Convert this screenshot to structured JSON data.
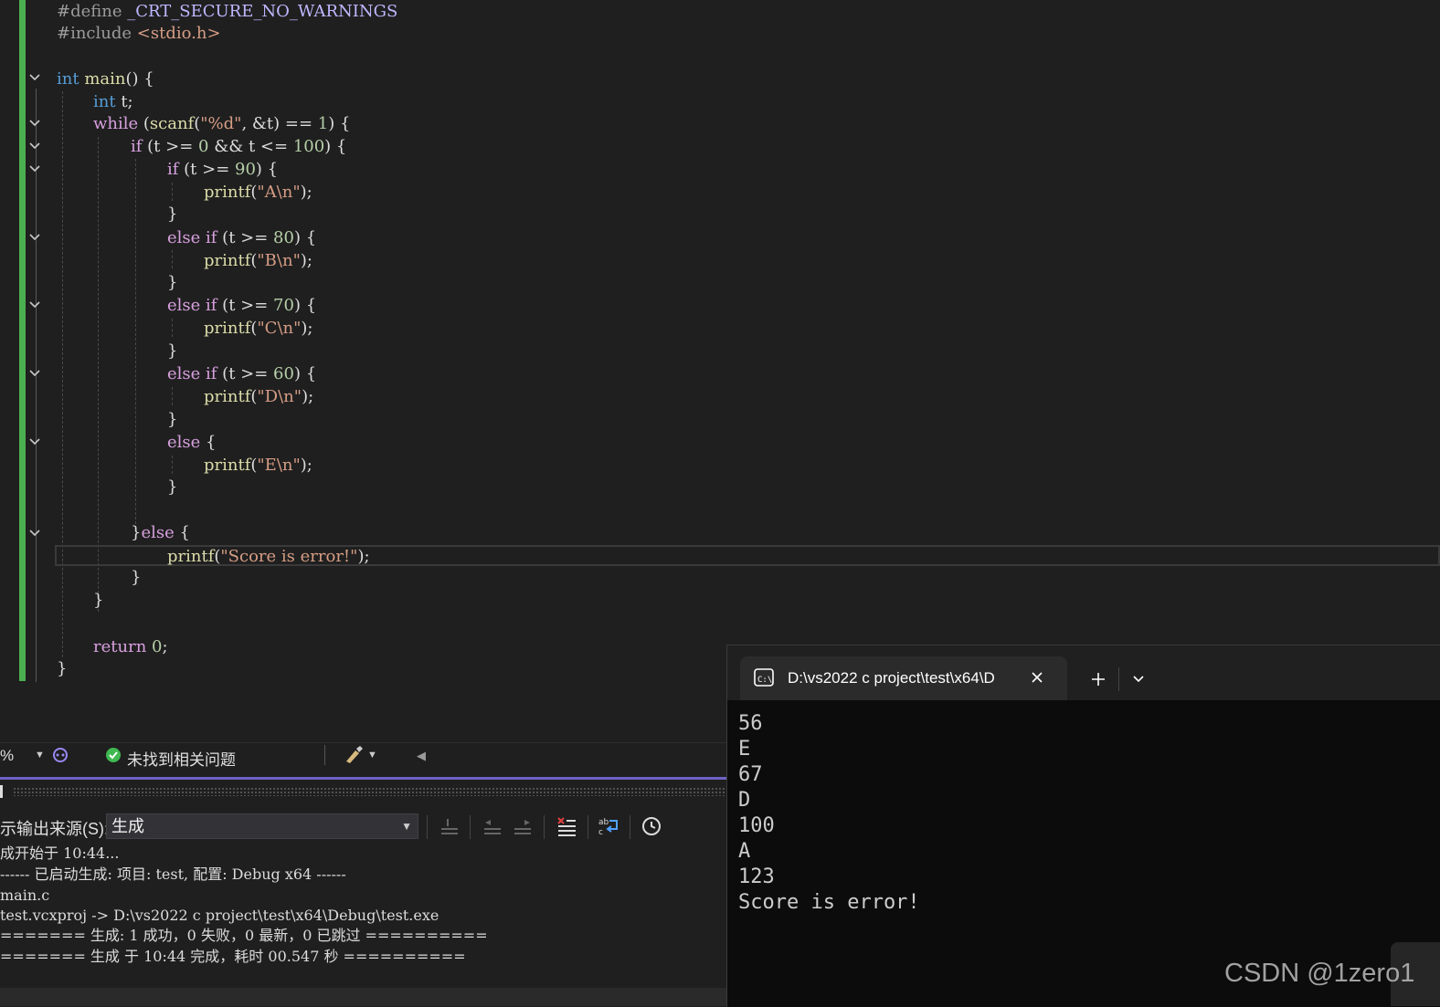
{
  "editor": {
    "lines": [
      {
        "id": "l1",
        "segments": [
          {
            "t": "#define",
            "c": "pp"
          },
          {
            "t": " ",
            "c": ""
          },
          {
            "t": "_CRT_SECURE_NO_WARNINGS",
            "c": "macro"
          }
        ]
      },
      {
        "id": "l2",
        "segments": [
          {
            "t": "#include",
            "c": "pp"
          },
          {
            "t": " ",
            "c": ""
          },
          {
            "t": "<stdio.h>",
            "c": "str"
          }
        ]
      },
      {
        "id": "l4",
        "segments": [
          {
            "t": "int",
            "c": "kw"
          },
          {
            "t": " ",
            "c": ""
          },
          {
            "t": "main",
            "c": "fn"
          },
          {
            "t": "() {",
            "c": ""
          }
        ]
      },
      {
        "id": "l5",
        "segments": [
          {
            "t": "int",
            "c": "kw"
          },
          {
            "t": " t;",
            "c": ""
          }
        ]
      },
      {
        "id": "l6",
        "segments": [
          {
            "t": "while",
            "c": "ctl"
          },
          {
            "t": " (",
            "c": ""
          },
          {
            "t": "scanf",
            "c": "fn"
          },
          {
            "t": "(",
            "c": ""
          },
          {
            "t": "\"%d\"",
            "c": "str"
          },
          {
            "t": ", &t) == ",
            "c": ""
          },
          {
            "t": "1",
            "c": "num"
          },
          {
            "t": ") {",
            "c": ""
          }
        ]
      },
      {
        "id": "l7",
        "segments": [
          {
            "t": "if",
            "c": "ctl"
          },
          {
            "t": " (t >= ",
            "c": ""
          },
          {
            "t": "0",
            "c": "num"
          },
          {
            "t": " && t <= ",
            "c": ""
          },
          {
            "t": "100",
            "c": "num"
          },
          {
            "t": ") {",
            "c": ""
          }
        ]
      },
      {
        "id": "l8",
        "segments": [
          {
            "t": "if",
            "c": "ctl"
          },
          {
            "t": " (t >= ",
            "c": ""
          },
          {
            "t": "90",
            "c": "num"
          },
          {
            "t": ") {",
            "c": ""
          }
        ]
      },
      {
        "id": "l9",
        "segments": [
          {
            "t": "printf",
            "c": "fn"
          },
          {
            "t": "(",
            "c": ""
          },
          {
            "t": "\"A\\n\"",
            "c": "str"
          },
          {
            "t": ");",
            "c": ""
          }
        ]
      },
      {
        "id": "l10",
        "segments": [
          {
            "t": "}",
            "c": ""
          }
        ]
      },
      {
        "id": "l11",
        "segments": [
          {
            "t": "else if",
            "c": "ctl"
          },
          {
            "t": " (t >= ",
            "c": ""
          },
          {
            "t": "80",
            "c": "num"
          },
          {
            "t": ") {",
            "c": ""
          }
        ]
      },
      {
        "id": "l12",
        "segments": [
          {
            "t": "printf",
            "c": "fn"
          },
          {
            "t": "(",
            "c": ""
          },
          {
            "t": "\"B\\n\"",
            "c": "str"
          },
          {
            "t": ");",
            "c": ""
          }
        ]
      },
      {
        "id": "l13",
        "segments": [
          {
            "t": "}",
            "c": ""
          }
        ]
      },
      {
        "id": "l14",
        "segments": [
          {
            "t": "else if",
            "c": "ctl"
          },
          {
            "t": " (t >= ",
            "c": ""
          },
          {
            "t": "70",
            "c": "num"
          },
          {
            "t": ") {",
            "c": ""
          }
        ]
      },
      {
        "id": "l15",
        "segments": [
          {
            "t": "printf",
            "c": "fn"
          },
          {
            "t": "(",
            "c": ""
          },
          {
            "t": "\"C\\n\"",
            "c": "str"
          },
          {
            "t": ");",
            "c": ""
          }
        ]
      },
      {
        "id": "l16",
        "segments": [
          {
            "t": "}",
            "c": ""
          }
        ]
      },
      {
        "id": "l17",
        "segments": [
          {
            "t": "else if",
            "c": "ctl"
          },
          {
            "t": " (t >= ",
            "c": ""
          },
          {
            "t": "60",
            "c": "num"
          },
          {
            "t": ") {",
            "c": ""
          }
        ]
      },
      {
        "id": "l18",
        "segments": [
          {
            "t": "printf",
            "c": "fn"
          },
          {
            "t": "(",
            "c": ""
          },
          {
            "t": "\"D\\n\"",
            "c": "str"
          },
          {
            "t": ");",
            "c": ""
          }
        ]
      },
      {
        "id": "l19",
        "segments": [
          {
            "t": "}",
            "c": ""
          }
        ]
      },
      {
        "id": "l20",
        "segments": [
          {
            "t": "else",
            "c": "ctl"
          },
          {
            "t": " {",
            "c": ""
          }
        ]
      },
      {
        "id": "l21",
        "segments": [
          {
            "t": "printf",
            "c": "fn"
          },
          {
            "t": "(",
            "c": ""
          },
          {
            "t": "\"E\\n\"",
            "c": "str"
          },
          {
            "t": ");",
            "c": ""
          }
        ]
      },
      {
        "id": "l22",
        "segments": [
          {
            "t": "}",
            "c": ""
          }
        ]
      },
      {
        "id": "l24",
        "segments": [
          {
            "t": "}",
            "c": ""
          },
          {
            "t": "else",
            "c": "ctl"
          },
          {
            "t": " {",
            "c": ""
          }
        ]
      },
      {
        "id": "l25",
        "segments": [
          {
            "t": "printf",
            "c": "fn"
          },
          {
            "t": "(",
            "c": ""
          },
          {
            "t": "\"Score is error!\"",
            "c": "str"
          },
          {
            "t": ");",
            "c": ""
          }
        ]
      },
      {
        "id": "l26",
        "segments": [
          {
            "t": "}",
            "c": ""
          }
        ]
      },
      {
        "id": "l27",
        "segments": [
          {
            "t": "}",
            "c": ""
          }
        ]
      },
      {
        "id": "l29",
        "segments": [
          {
            "t": "return",
            "c": "ctl"
          },
          {
            "t": " ",
            "c": ""
          },
          {
            "t": "0",
            "c": "num"
          },
          {
            "t": ";",
            "c": ""
          }
        ]
      },
      {
        "id": "l30",
        "segments": [
          {
            "t": "}",
            "c": ""
          }
        ]
      }
    ]
  },
  "statusbar": {
    "zoom": "%",
    "issues": "未找到相关问题"
  },
  "output": {
    "source_label": "示输出来源(S):",
    "source_value": "生成",
    "lines": [
      "成开始于 10:44...",
      "------ 已启动生成: 项目: test, 配置: Debug x64 ------",
      "main.c",
      "test.vcxproj -> D:\\vs2022 c project\\test\\x64\\Debug\\test.exe",
      "======= 生成: 1 成功，0 失败，0 最新，0 已跳过 ==========",
      "======= 生成 于 10:44 完成，耗时 00.547 秒 =========="
    ]
  },
  "terminal": {
    "tab_title": "D:\\vs2022 c project\\test\\x64\\D",
    "lines": [
      "56",
      "E",
      "67",
      "D",
      "100",
      "A",
      "123",
      "Score is error!"
    ]
  },
  "watermark": "CSDN @1zero1"
}
